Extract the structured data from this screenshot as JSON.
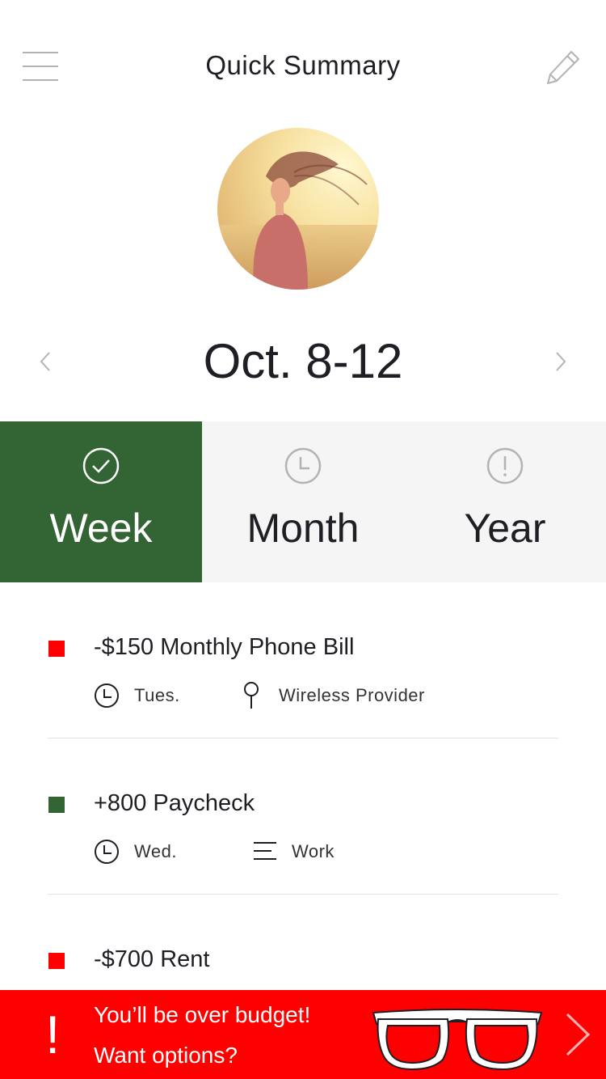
{
  "header": {
    "title": "Quick Summary",
    "menu_icon": "hamburger-menu-icon",
    "edit_icon": "pencil-icon"
  },
  "profile": {
    "avatar": "profile-photo"
  },
  "period": {
    "label": "Oct. 8-12",
    "prev_icon": "chevron-left-icon",
    "next_icon": "chevron-right-icon"
  },
  "tabs": [
    {
      "label": "Week",
      "icon": "check-circle-icon",
      "active": true
    },
    {
      "label": "Month",
      "icon": "clock-icon",
      "active": false
    },
    {
      "label": "Year",
      "icon": "alert-circle-icon",
      "active": false
    }
  ],
  "transactions": [
    {
      "title": "-$150 Monthly Phone Bill",
      "color": "#fe0000",
      "day": "Tues.",
      "detail": "Wireless Provider",
      "detail_icon": "location-pin-icon"
    },
    {
      "title": "+800 Paycheck",
      "color": "#336434",
      "day": "Wed.",
      "detail": "Work",
      "detail_icon": "list-lines-icon"
    },
    {
      "title": "-$700 Rent",
      "color": "#fe0000"
    }
  ],
  "alert": {
    "icon_text": "!",
    "line1": "You’ll be over budget!",
    "line2": "Want options?",
    "image": "glasses-icon",
    "arrow": "chevron-right-icon"
  },
  "colors": {
    "primary_green": "#336434",
    "alert_red": "#fe0000",
    "tab_bg": "#f5f5f5"
  }
}
